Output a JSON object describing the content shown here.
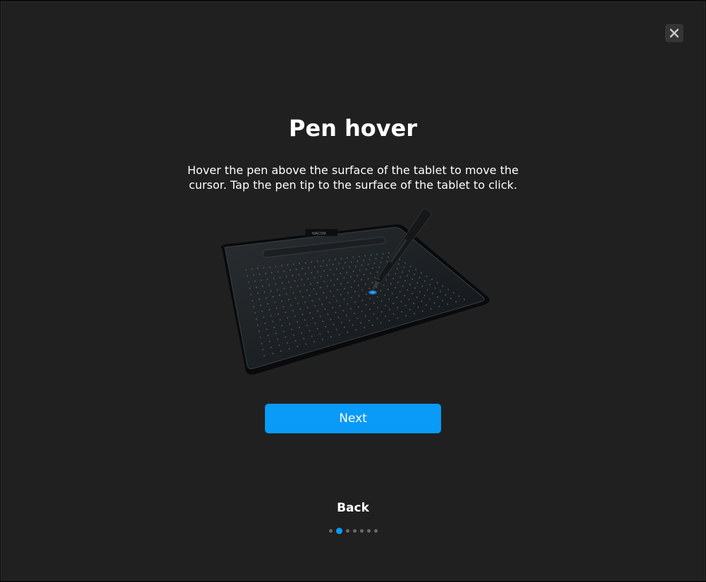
{
  "dialog": {
    "title": "Pen hover",
    "description": "Hover the pen above the surface of the tablet to move the cursor. Tap the pen tip to the surface of the tablet to click.",
    "next_label": "Next",
    "back_label": "Back",
    "close_icon": "close-icon",
    "tablet_brand": "WACOM"
  },
  "pagination": {
    "total": 7,
    "current": 2
  },
  "colors": {
    "accent": "#0a9af7",
    "background": "#202020",
    "text": "#ffffff",
    "inactive_dot": "#6b6b6b"
  }
}
